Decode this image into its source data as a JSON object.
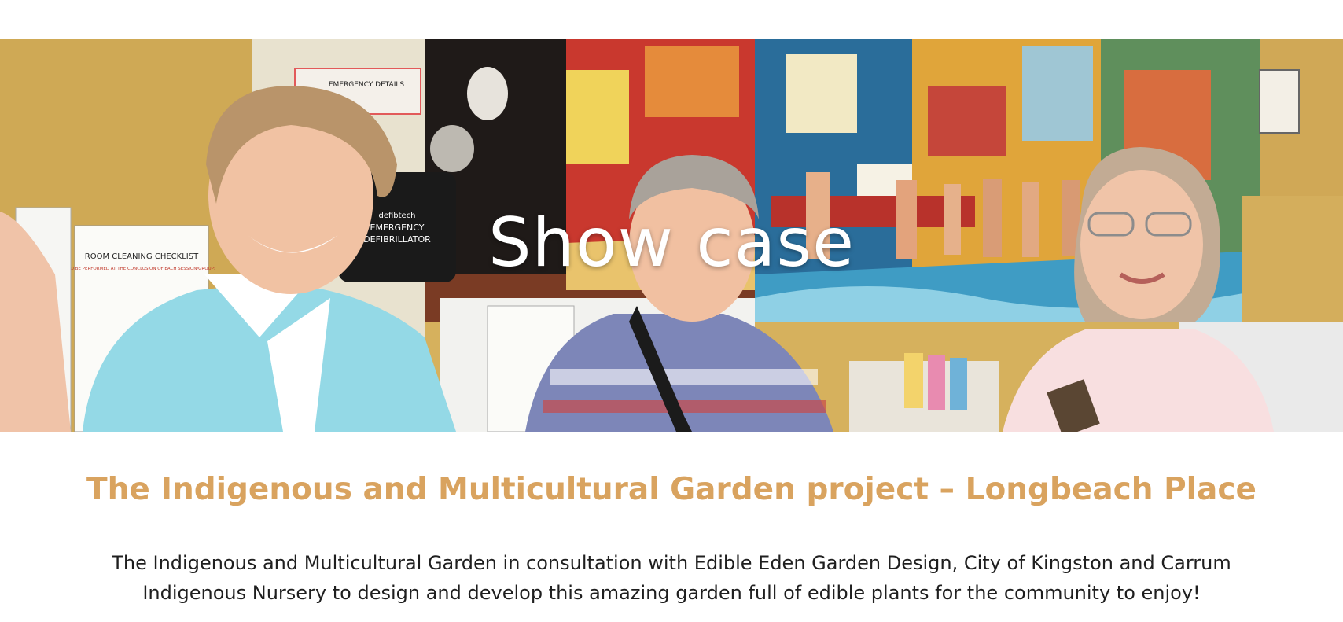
{
  "hero": {
    "title": "Show case",
    "image": {
      "emergency_sign": "EMERGENCY DETAILS",
      "defib_brand": "defibtech",
      "defib_label_1": "EMERGENCY",
      "defib_label_2": "DEFIBRILLATOR",
      "checklist_title": "ROOM CLEANING CHECKLIST",
      "checklist_subtitle": "TO BE PERFORMED AT THE CONCLUSION OF EACH SESSION/GROUP:"
    }
  },
  "section": {
    "title": "The Indigenous and Multicultural Garden project – Longbeach Place",
    "description": "The Indigenous and Multicultural Garden in consultation with Edible Eden Garden Design, City of Kingston and Carrum Indigenous Nursery to design and develop this amazing garden full of edible plants for the community to enjoy!"
  },
  "colors": {
    "accent": "#d9a35f",
    "body_text": "#1f1f1f",
    "hero_text": "#ffffff"
  }
}
